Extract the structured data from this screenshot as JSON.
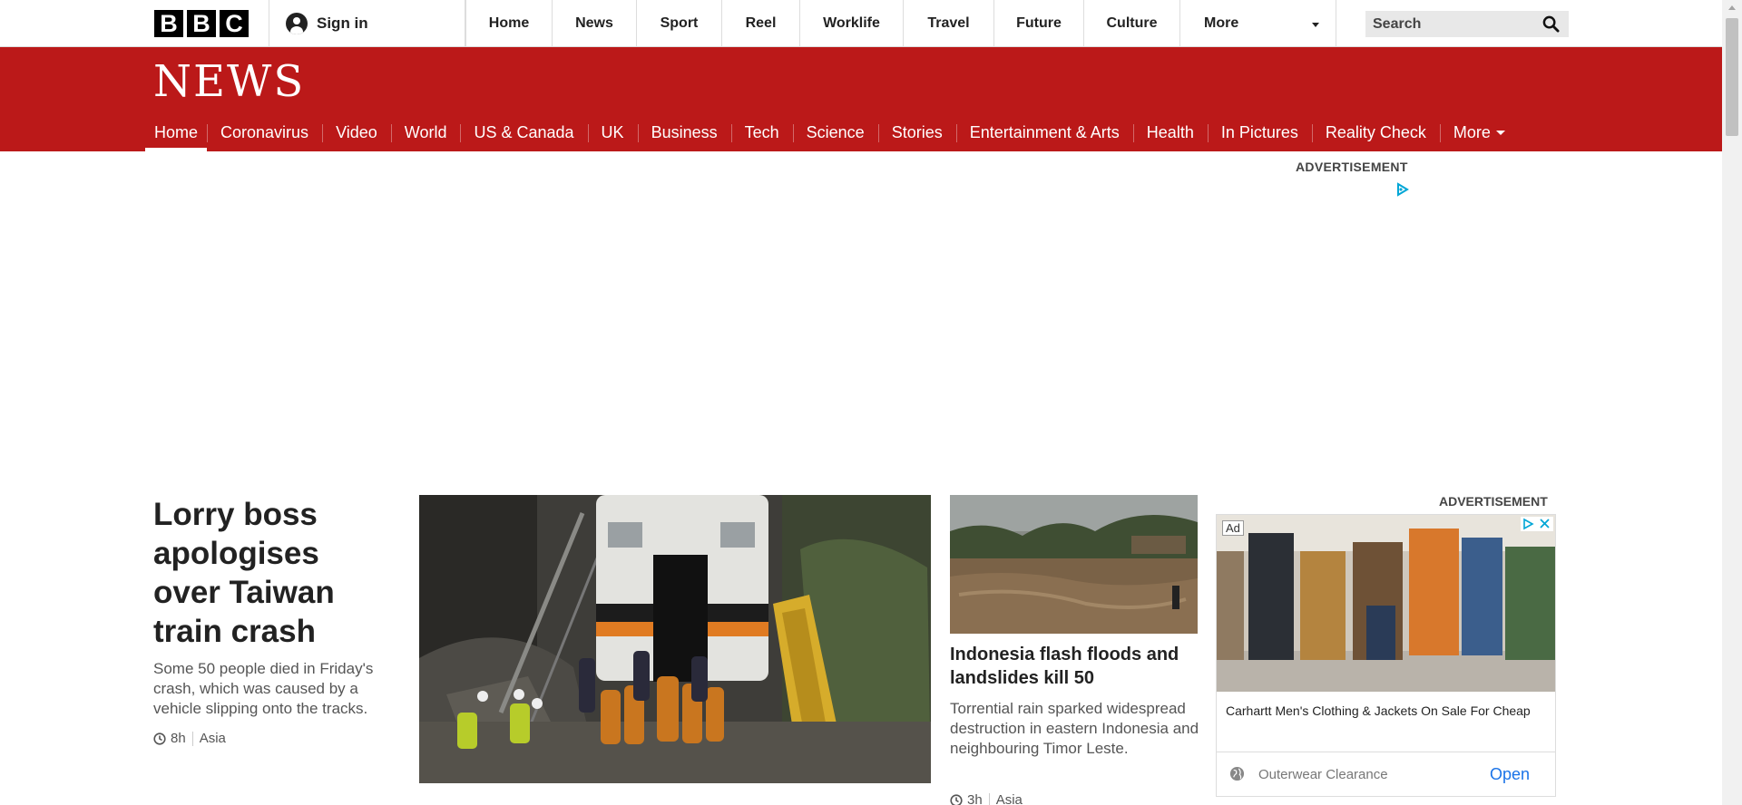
{
  "topbar": {
    "logo": [
      "B",
      "B",
      "C"
    ],
    "sign_in": "Sign in",
    "nav": [
      "Home",
      "News",
      "Sport",
      "Reel",
      "Worklife",
      "Travel",
      "Future",
      "Culture"
    ],
    "more": "More",
    "search_placeholder": "Search"
  },
  "news": {
    "title": "NEWS",
    "subnav": [
      "Home",
      "Coronavirus",
      "Video",
      "World",
      "US & Canada",
      "UK",
      "Business",
      "Tech",
      "Science",
      "Stories",
      "Entertainment & Arts",
      "Health",
      "In Pictures",
      "Reality Check"
    ],
    "more": "More",
    "active": "Home"
  },
  "top_ad": {
    "label": "ADVERTISEMENT"
  },
  "lead_story": {
    "headline": "Lorry boss apologises over Taiwan train crash",
    "summary": "Some 50 people died in Friday's crash, which was caused by a vehicle slipping onto the tracks.",
    "time": "8h",
    "section": "Asia"
  },
  "second_story": {
    "headline": "Indonesia flash floods and landslides kill 50",
    "summary": "Torrential rain sparked widespread destruction in eastern Indonesia and neighbouring Timor Leste.",
    "time": "3h",
    "section": "Asia"
  },
  "side_ad": {
    "label": "ADVERTISEMENT",
    "tag": "Ad",
    "headline": "Carhartt Men's Clothing & Jackets On Sale For Cheap",
    "domain": "Outerwear Clearance",
    "cta": "Open"
  },
  "colors": {
    "brand_red": "#bb1919",
    "link_blue": "#1a73e8"
  }
}
